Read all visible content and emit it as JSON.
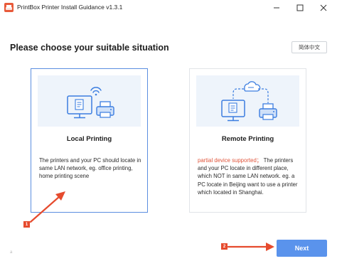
{
  "window": {
    "title": "PrintBox Printer Install Guidance v1.3.1"
  },
  "main": {
    "heading": "Please choose your suitable situation",
    "language_button": "简体中文"
  },
  "options": [
    {
      "title": "Local Printing",
      "description": "The printers and your PC should locate in same LAN network, eg. office printing, home printing scene",
      "selected": true
    },
    {
      "title": "Remote Printing",
      "highlight": "partial device supported；",
      "description": " The printers and your PC locate in different place, which NOT in same LAN network. eg. a PC locate in Beijing want to use a printer which located in Shanghai.",
      "selected": false
    }
  ],
  "annotations": {
    "marker_1": "1",
    "marker_2": "2",
    "corner_mark": "a"
  },
  "footer": {
    "next_label": "Next"
  },
  "colors": {
    "accent": "#5a93ec",
    "selected_border": "#5b8ee0",
    "annotation": "#e64b2e",
    "illustration_bg": "#eef4fb"
  }
}
